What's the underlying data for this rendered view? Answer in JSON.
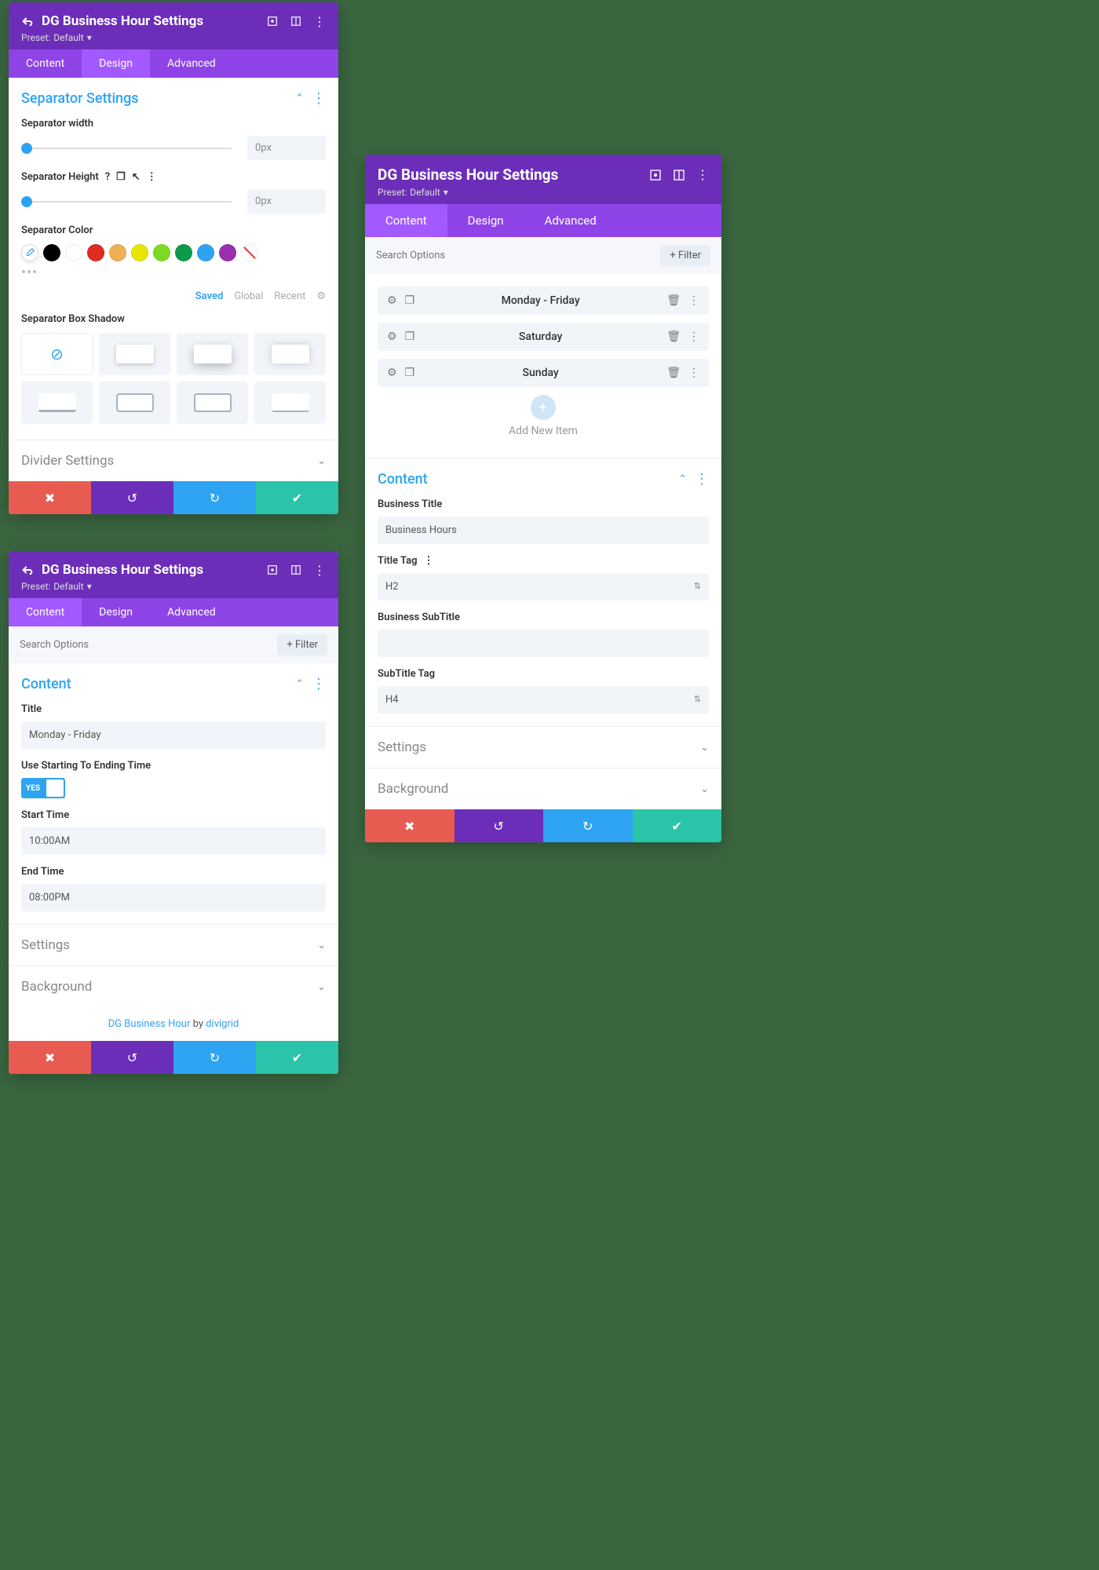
{
  "common": {
    "module_title": "DG Business Hour Settings",
    "preset_label": "Preset:",
    "preset_value": "Default",
    "tabs": {
      "content": "Content",
      "design": "Design",
      "advanced": "Advanced"
    }
  },
  "panel1": {
    "section_title": "Separator Settings",
    "width_label": "Separator width",
    "width_value": "0px",
    "height_label": "Separator Height",
    "height_value": "0px",
    "color_label": "Separator Color",
    "palette_tabs": {
      "saved": "Saved",
      "global": "Global",
      "recent": "Recent"
    },
    "shadow_label": "Separator Box Shadow",
    "divider_section": "Divider Settings",
    "swatches": [
      "#000000",
      "#ffffff",
      "#e02b20",
      "#edb059",
      "#e6e600",
      "#7cda24",
      "#0c9b49",
      "#2ea3f2",
      "#9b2fae"
    ]
  },
  "panel2": {
    "search_placeholder": "Search Options",
    "filter_label": "Filter",
    "content_section": "Content",
    "title_label": "Title",
    "title_value": "Monday - Friday",
    "use_range_label": "Use Starting To Ending Time",
    "toggle_value": "YES",
    "start_label": "Start Time",
    "start_value": "10:00AM",
    "end_label": "End Time",
    "end_value": "08:00PM",
    "settings_section": "Settings",
    "background_section": "Background",
    "credit_module": "DG Business Hour",
    "credit_by": "by",
    "credit_author": "divigrid"
  },
  "panel3": {
    "search_placeholder": "Search Options",
    "filter_label": "Filter",
    "items": [
      "Monday - Friday",
      "Saturday",
      "Sunday"
    ],
    "add_label": "Add New Item",
    "content_section": "Content",
    "btitle_label": "Business Title",
    "btitle_value": "Business Hours",
    "title_tag_label": "Title Tag",
    "title_tag_value": "H2",
    "bsub_label": "Business SubTitle",
    "bsub_value": "",
    "sub_tag_label": "SubTitle Tag",
    "sub_tag_value": "H4",
    "settings_section": "Settings",
    "background_section": "Background"
  }
}
